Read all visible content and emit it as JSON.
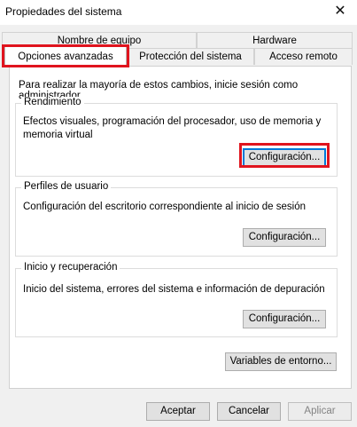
{
  "window": {
    "title": "Propiedades del sistema"
  },
  "tabs": {
    "row1": [
      "Nombre de equipo",
      "Hardware"
    ],
    "row2": [
      "Opciones avanzadas",
      "Protección del sistema",
      "Acceso remoto"
    ],
    "active": "Opciones avanzadas"
  },
  "intro": "Para realizar la mayoría de estos cambios, inicie sesión como administrador.",
  "performance": {
    "title": "Rendimiento",
    "desc_line1": "Efectos visuales, programación del procesador, uso de memoria y",
    "desc_line2": "memoria virtual",
    "button": "Configuración..."
  },
  "profiles": {
    "title": "Perfiles de usuario",
    "desc": "Configuración del escritorio correspondiente al inicio de sesión",
    "button": "Configuración..."
  },
  "startup": {
    "title": "Inicio y recuperación",
    "desc": "Inicio del sistema, errores del sistema e información de depuración",
    "button": "Configuración..."
  },
  "env_button": "Variables de entorno...",
  "footer": {
    "ok": "Aceptar",
    "cancel": "Cancelar",
    "apply": "Aplicar"
  },
  "highlight_color": "#e0141e",
  "icons": [
    "close-icon"
  ]
}
